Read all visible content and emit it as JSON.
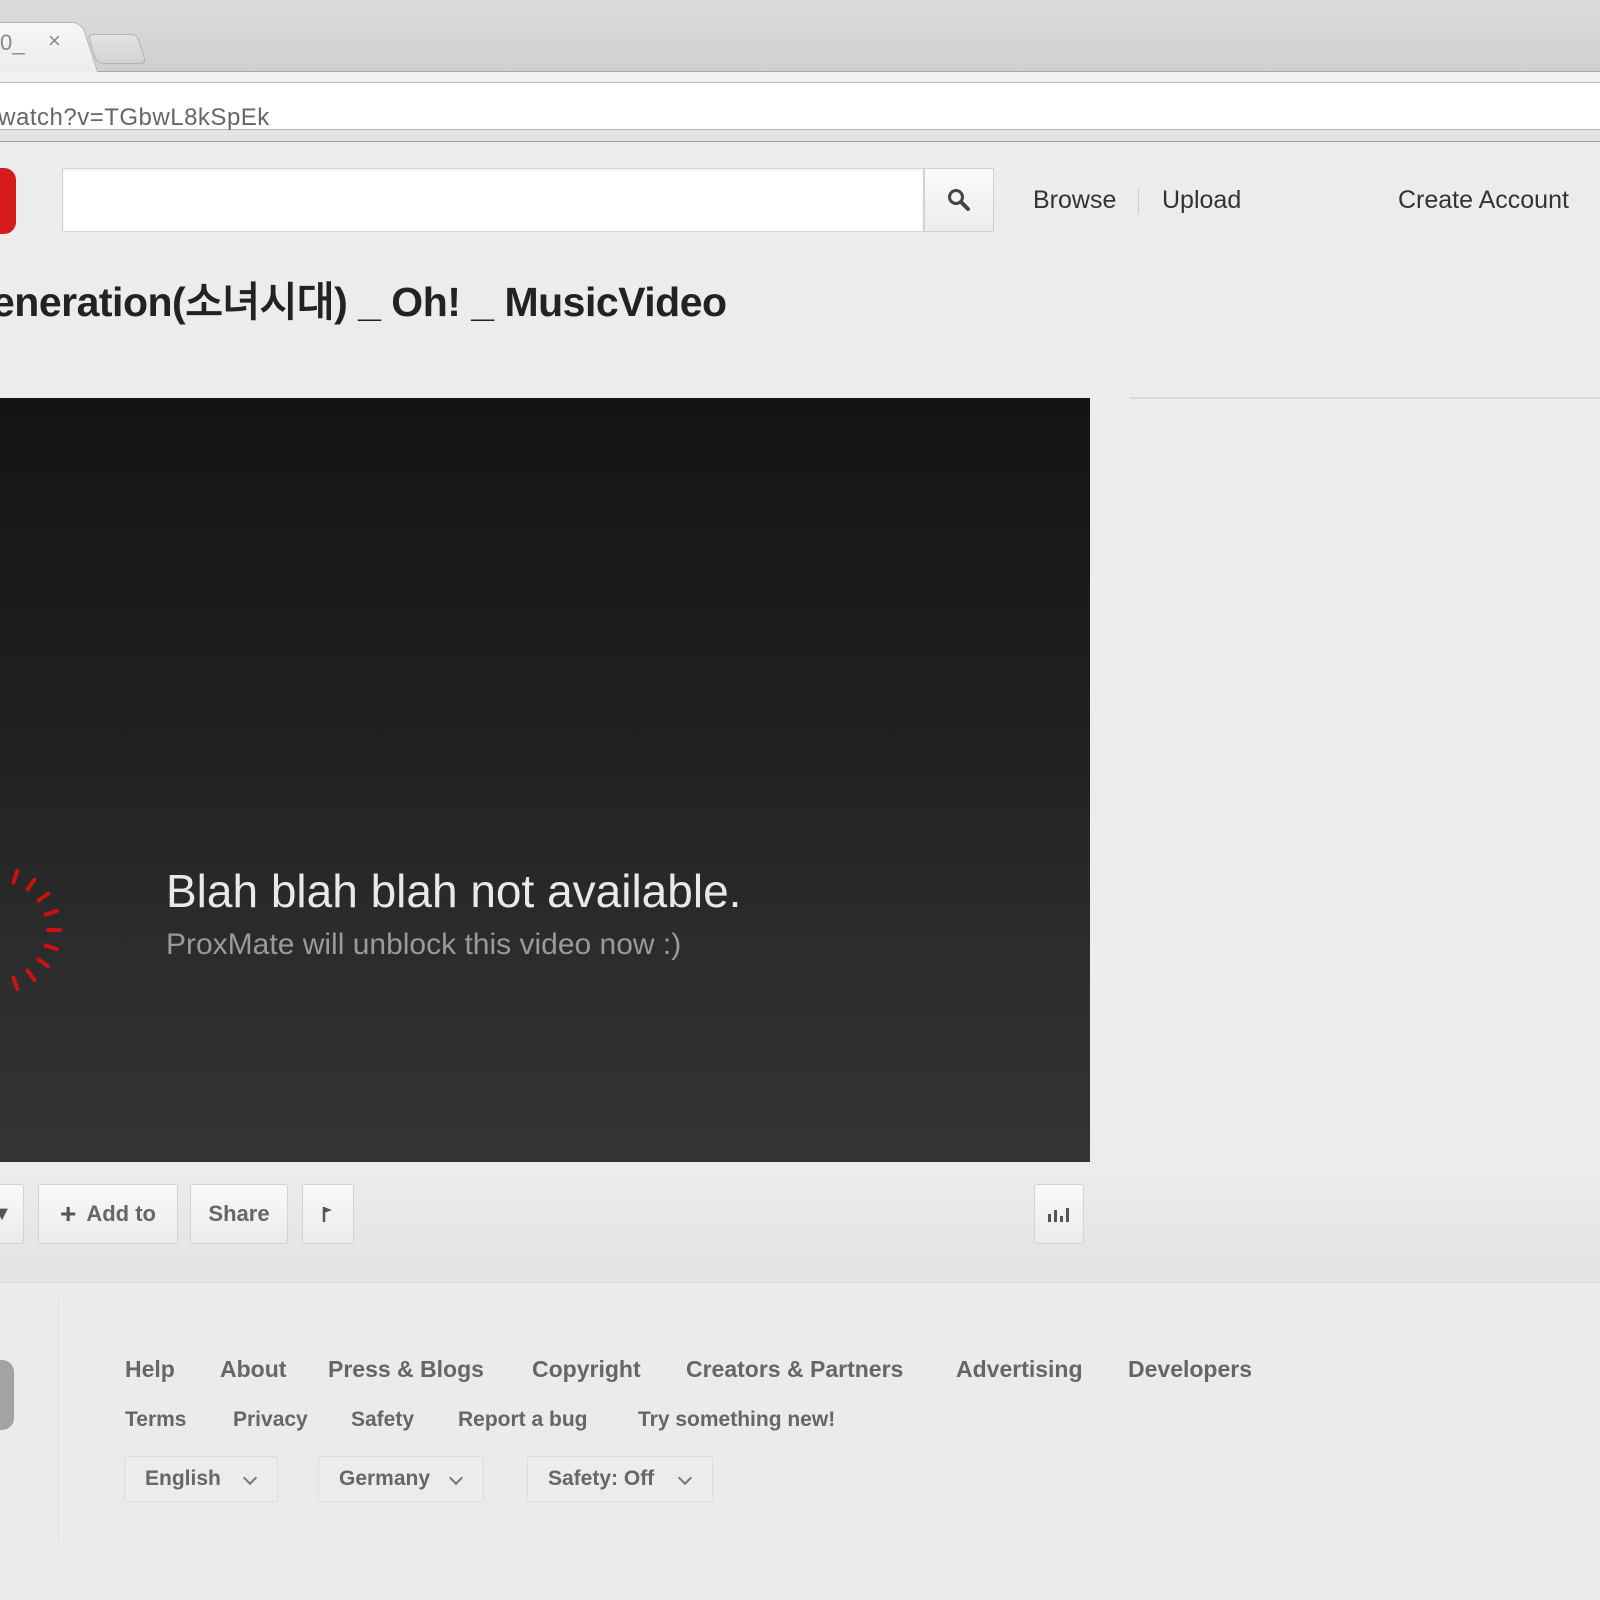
{
  "browser": {
    "tab_title": "0_",
    "tab_close": "×",
    "url": "/watch?v=TGbwL8kSpEk"
  },
  "header": {
    "search_placeholder": "",
    "nav": {
      "browse": "Browse",
      "upload": "Upload",
      "create_account": "Create Account"
    }
  },
  "video": {
    "title": "eneration(소녀시대) _ Oh! _ MusicVideo",
    "message_title": "Blah blah blah not available.",
    "message_subtitle": "ProxMate will unblock this video now :)"
  },
  "actions": {
    "add_to": "Add to",
    "share": "Share"
  },
  "footer": {
    "links_primary": [
      "Help",
      "About",
      "Press & Blogs",
      "Copyright",
      "Creators & Partners",
      "Advertising",
      "Developers"
    ],
    "links_secondary": [
      "Terms",
      "Privacy",
      "Safety",
      "Report a bug",
      "Try something new!"
    ],
    "language": "English",
    "country": "Germany",
    "safety": "Safety: Off"
  },
  "colors": {
    "brand_red": "#d51b1b",
    "spinner_red": "#cc1111"
  }
}
